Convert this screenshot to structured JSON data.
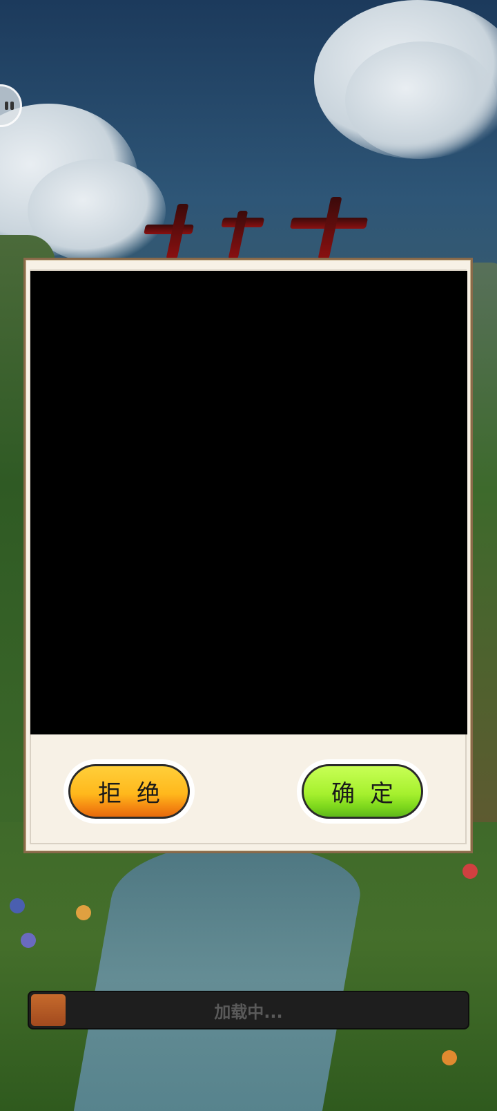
{
  "dialog": {
    "refuse_label": "拒绝",
    "confirm_label": "确定"
  },
  "loading": {
    "text": "加载中...",
    "progress": 0.08
  },
  "colors": {
    "refuse_button": "#ffb81c",
    "confirm_button": "#a6f02e",
    "dialog_background": "#f7f1e6",
    "content_area": "#000000"
  },
  "icons": {
    "floating_button": "floating-assistant-icon"
  }
}
